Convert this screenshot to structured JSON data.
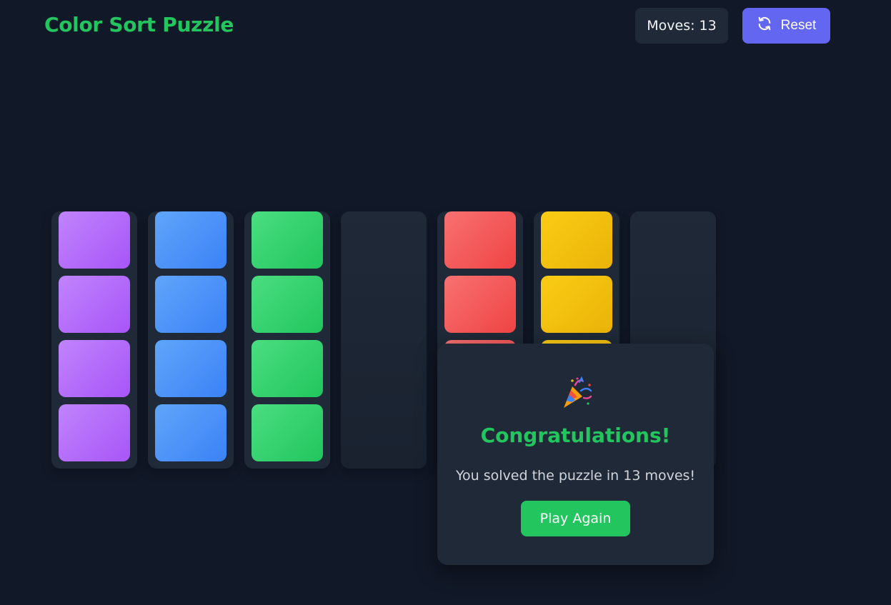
{
  "header": {
    "title": "Color Sort Puzzle",
    "moves_label": "Moves: 13",
    "reset_label": "Reset",
    "reset_icon": "refresh-icon"
  },
  "colors": {
    "background": "#111827",
    "panel": "#1f2937",
    "accent_green": "#22c55e",
    "accent_indigo": "#6366f1",
    "purple": [
      "#c084fc",
      "#a855f7"
    ],
    "blue": [
      "#60a5fa",
      "#3b82f6"
    ],
    "green": [
      "#4ade80",
      "#22c55e"
    ],
    "red": [
      "#f87171",
      "#ef4444"
    ],
    "yellow": [
      "#facc15",
      "#eab308"
    ]
  },
  "board": {
    "tubes": [
      {
        "balls": [
          "purple",
          "purple",
          "purple",
          "purple"
        ]
      },
      {
        "balls": [
          "blue",
          "blue",
          "blue",
          "blue"
        ]
      },
      {
        "balls": [
          "green",
          "green",
          "green",
          "green"
        ]
      },
      {
        "balls": []
      },
      {
        "balls": [
          "red",
          "red",
          "red",
          "red"
        ]
      },
      {
        "balls": [
          "yellow",
          "yellow",
          "yellow",
          "yellow"
        ]
      },
      {
        "balls": []
      }
    ]
  },
  "modal": {
    "icon": "party-popper-icon",
    "heading": "Congratulations!",
    "message": "You solved the puzzle in 13 moves!",
    "button_label": "Play Again"
  }
}
